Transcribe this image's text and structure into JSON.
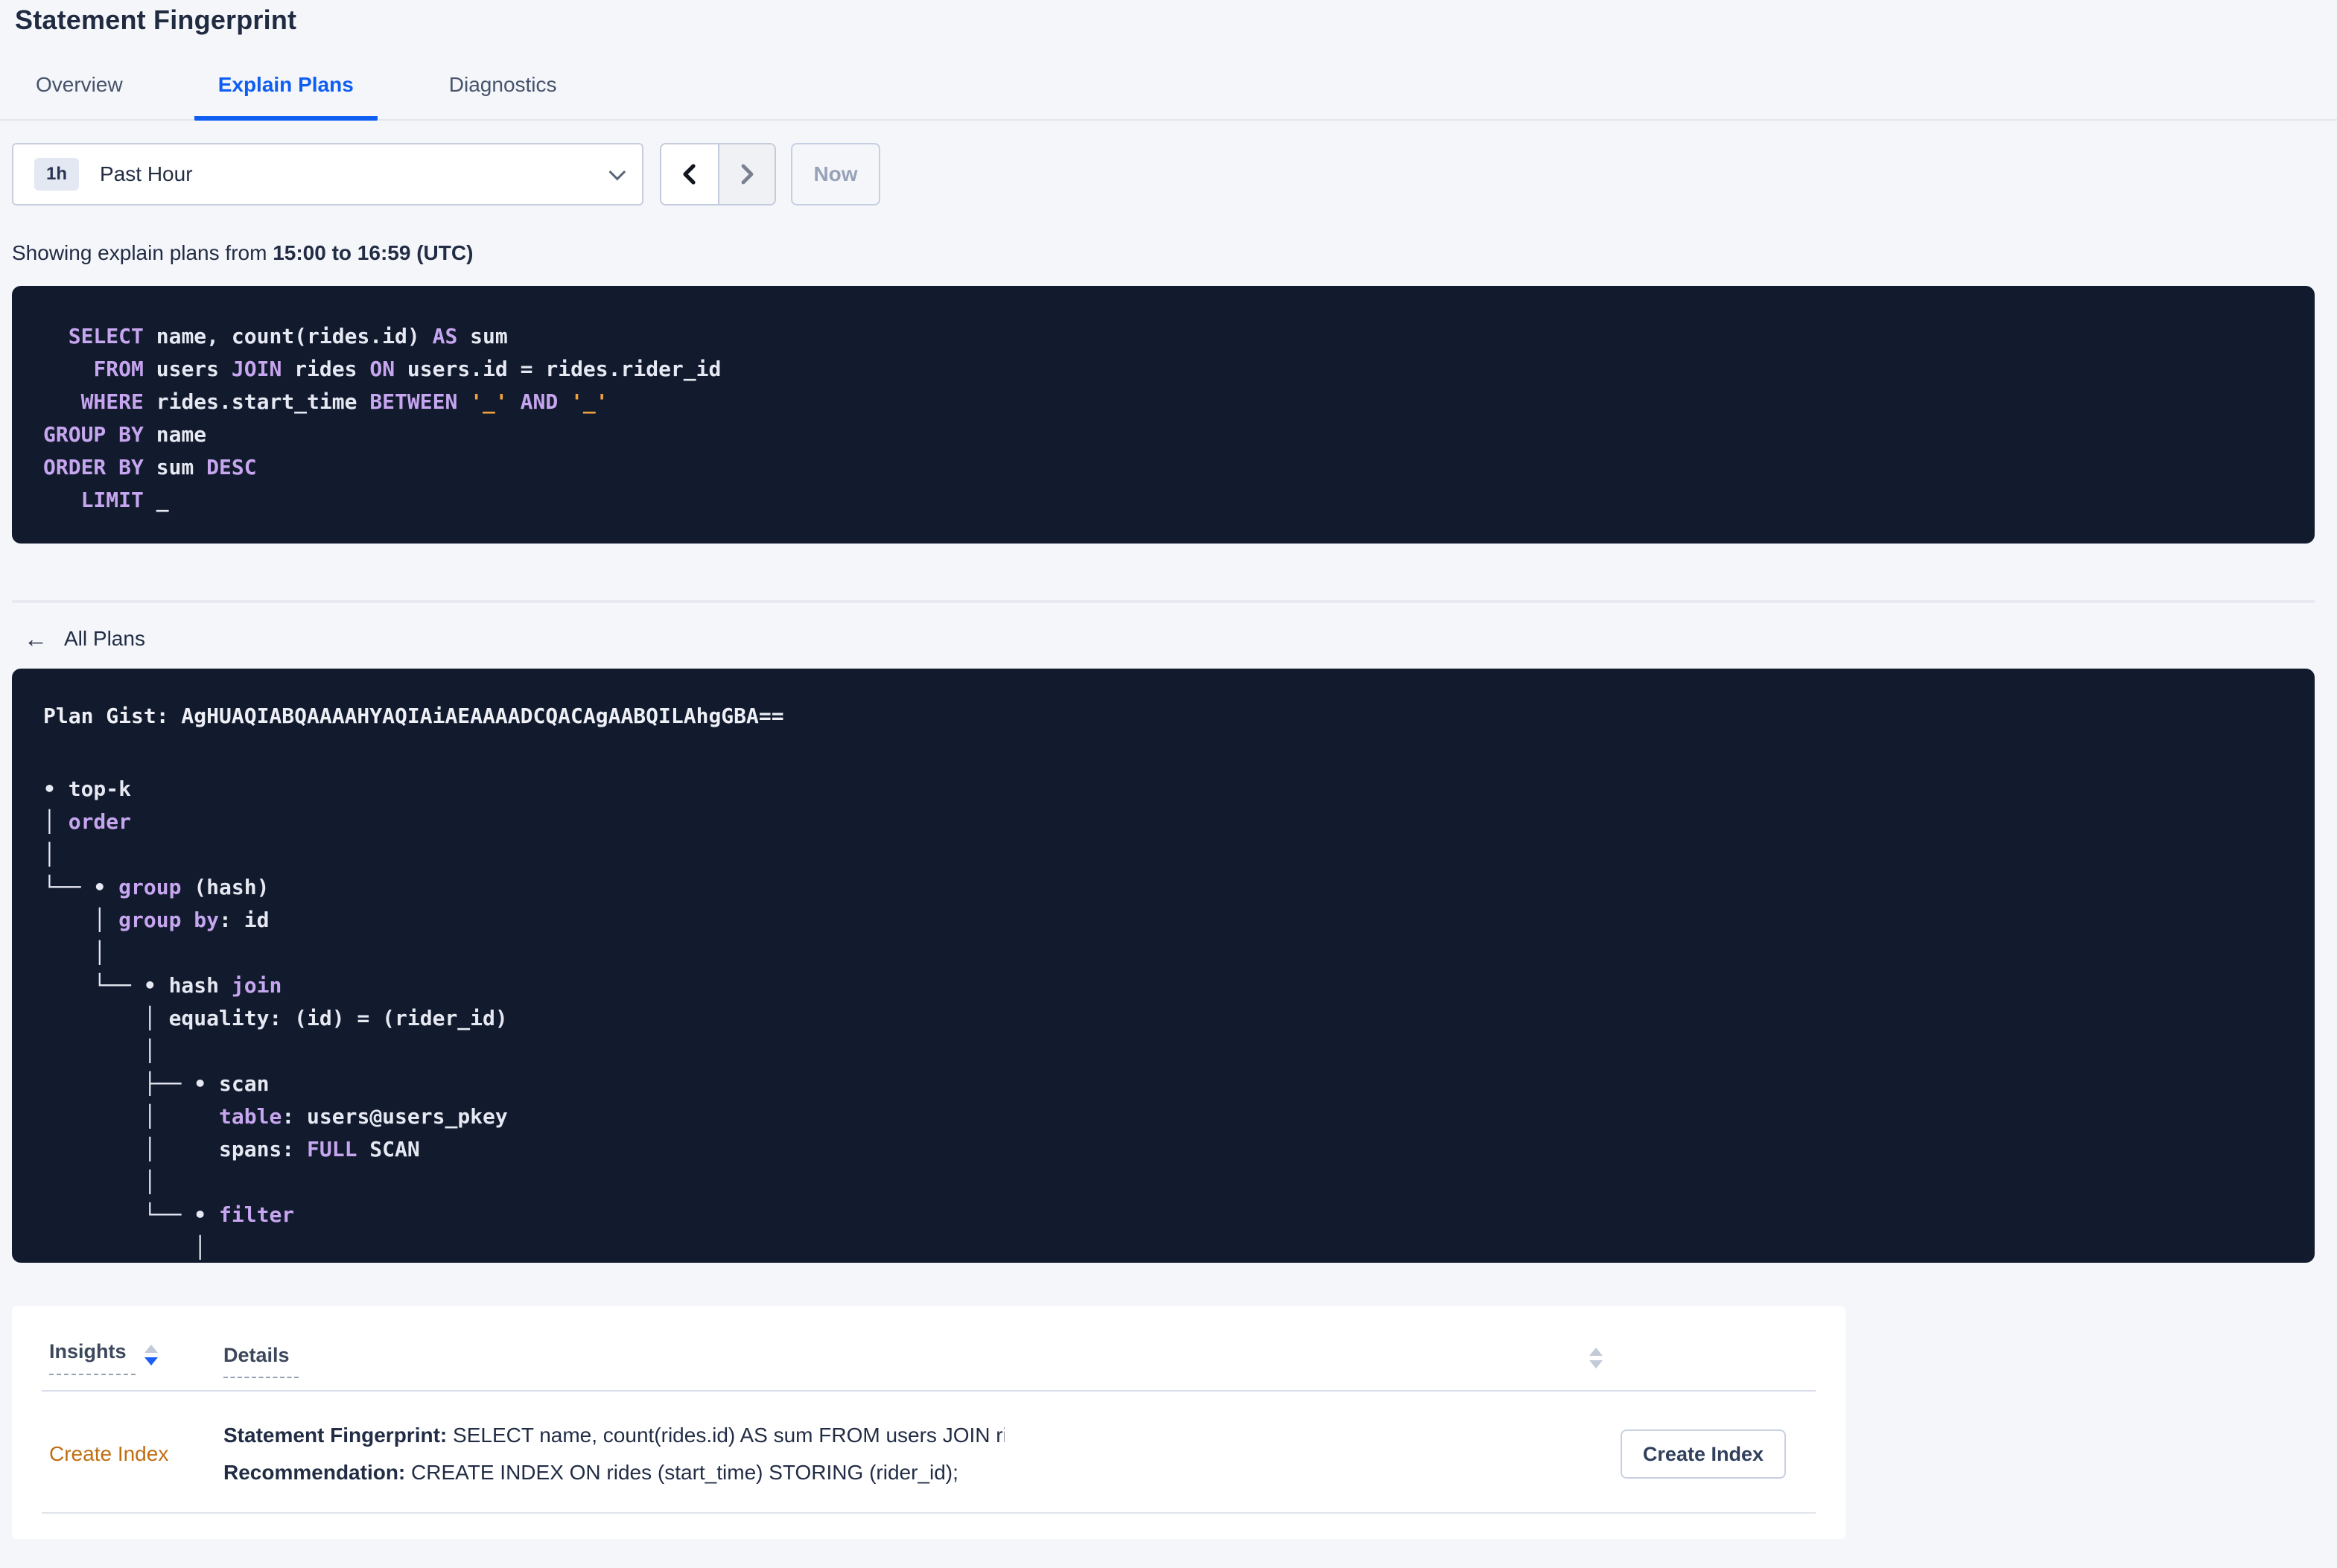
{
  "colors": {
    "accent-blue": "#0f5ef2",
    "code-bg": "#121a2e",
    "kw": "#c7a6f0",
    "code-plain": "#e6e9f2",
    "lit": "#f0a23d",
    "insight-link": "#c06e12"
  },
  "header": {
    "title": "Statement Fingerprint"
  },
  "tabs": [
    {
      "label": "Overview",
      "active": false
    },
    {
      "label": "Explain Plans",
      "active": true
    },
    {
      "label": "Diagnostics",
      "active": false
    }
  ],
  "time_picker": {
    "interval_badge": "1h",
    "selected_range": "Past Hour",
    "now_button": "Now"
  },
  "caption": {
    "prefix": "Showing explain plans from ",
    "range": "15:00 to 16:59 (UTC)"
  },
  "sql_box": {
    "lines": [
      [
        {
          "c": "p",
          "t": "  "
        },
        {
          "c": "k",
          "t": "SELECT"
        },
        {
          "c": "p",
          "t": " name, count(rides.id) "
        },
        {
          "c": "k",
          "t": "AS"
        },
        {
          "c": "p",
          "t": " sum"
        }
      ],
      [
        {
          "c": "p",
          "t": "    "
        },
        {
          "c": "k",
          "t": "FROM"
        },
        {
          "c": "p",
          "t": " users "
        },
        {
          "c": "k",
          "t": "JOIN"
        },
        {
          "c": "p",
          "t": " rides "
        },
        {
          "c": "k",
          "t": "ON"
        },
        {
          "c": "p",
          "t": " users.id = rides.rider_id"
        }
      ],
      [
        {
          "c": "p",
          "t": "   "
        },
        {
          "c": "k",
          "t": "WHERE"
        },
        {
          "c": "p",
          "t": " rides.start_time "
        },
        {
          "c": "k",
          "t": "BETWEEN"
        },
        {
          "c": "p",
          "t": " "
        },
        {
          "c": "o",
          "t": "'_'"
        },
        {
          "c": "p",
          "t": " "
        },
        {
          "c": "k",
          "t": "AND"
        },
        {
          "c": "p",
          "t": " "
        },
        {
          "c": "o",
          "t": "'_'"
        }
      ],
      [
        {
          "c": "k",
          "t": "GROUP BY"
        },
        {
          "c": "p",
          "t": " name"
        }
      ],
      [
        {
          "c": "k",
          "t": "ORDER BY"
        },
        {
          "c": "p",
          "t": " sum "
        },
        {
          "c": "k",
          "t": "DESC"
        }
      ],
      [
        {
          "c": "p",
          "t": "   "
        },
        {
          "c": "k",
          "t": "LIMIT"
        },
        {
          "c": "p",
          "t": " _"
        }
      ]
    ]
  },
  "back_link": {
    "arrow_icon": "←",
    "label": "All Plans"
  },
  "plan_box": {
    "gist_line": "Plan Gist: AgHUAQIABQAAAAHYAQIAiAEAAAADCQACAgAABQILAhgGBA==",
    "tree_lines": [
      [
        {
          "c": "p",
          "t": "• top-k"
        }
      ],
      [
        {
          "c": "p",
          "t": "│ "
        },
        {
          "c": "k",
          "t": "order"
        }
      ],
      [
        {
          "c": "p",
          "t": "│"
        }
      ],
      [
        {
          "c": "p",
          "t": "└── • "
        },
        {
          "c": "k",
          "t": "group"
        },
        {
          "c": "p",
          "t": " (hash)"
        }
      ],
      [
        {
          "c": "p",
          "t": "    │ "
        },
        {
          "c": "k",
          "t": "group by"
        },
        {
          "c": "p",
          "t": ": id"
        }
      ],
      [
        {
          "c": "p",
          "t": "    │"
        }
      ],
      [
        {
          "c": "p",
          "t": "    └── • hash "
        },
        {
          "c": "k",
          "t": "join"
        }
      ],
      [
        {
          "c": "p",
          "t": "        │ equality: (id) = (rider_id)"
        }
      ],
      [
        {
          "c": "p",
          "t": "        │"
        }
      ],
      [
        {
          "c": "p",
          "t": "        ├── • scan"
        }
      ],
      [
        {
          "c": "p",
          "t": "        │     "
        },
        {
          "c": "k",
          "t": "table"
        },
        {
          "c": "p",
          "t": ": users@users_pkey"
        }
      ],
      [
        {
          "c": "p",
          "t": "        │     spans: "
        },
        {
          "c": "k",
          "t": "FULL"
        },
        {
          "c": "p",
          "t": " SCAN"
        }
      ],
      [
        {
          "c": "p",
          "t": "        │"
        }
      ],
      [
        {
          "c": "p",
          "t": "        └── • "
        },
        {
          "c": "k",
          "t": "filter"
        }
      ],
      [
        {
          "c": "p",
          "t": "            │"
        }
      ]
    ]
  },
  "insights_table": {
    "columns": [
      "Insights",
      "Details"
    ],
    "rows": [
      {
        "insight": "Create Index",
        "details": [
          {
            "label": "Statement Fingerprint:",
            "text": " SELECT name, count(rides.id) AS sum FROM users JOIN rides ON users.id = rides.rider_id WHERE rides.start_time BETWEEN '_…"
          },
          {
            "label": "Recommendation:",
            "text": " CREATE INDEX ON rides (start_time) STORING (rider_id);"
          }
        ],
        "action_button": "Create Index"
      }
    ]
  }
}
